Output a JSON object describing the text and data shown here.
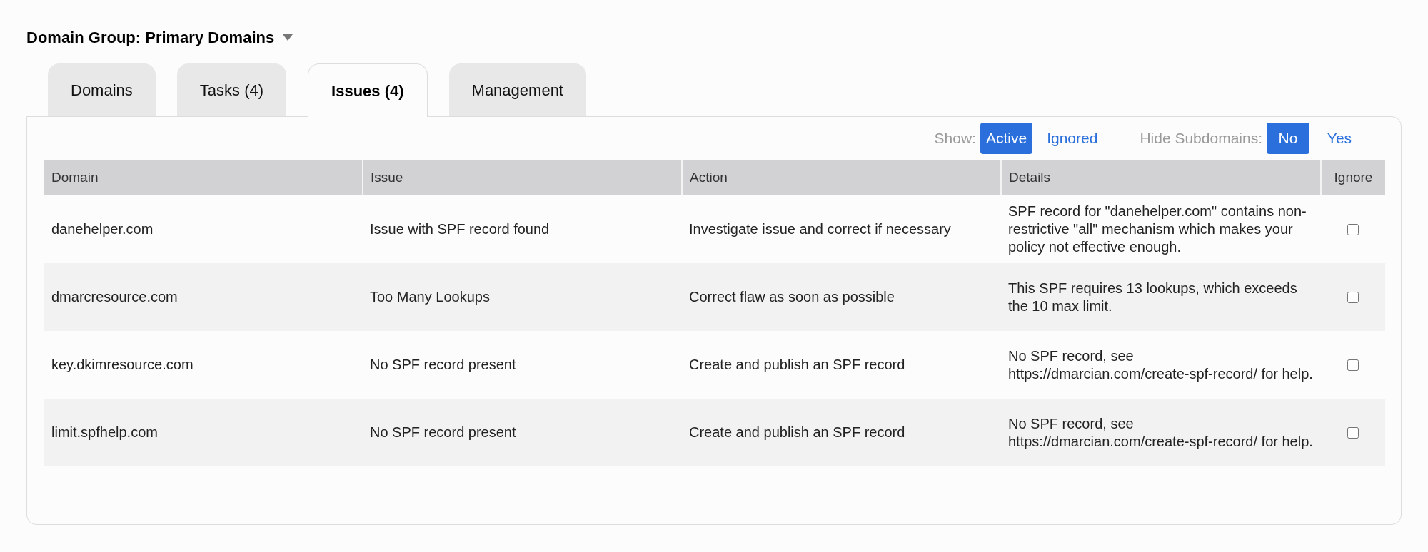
{
  "domain_group": {
    "label": "Domain Group: Primary Domains",
    "expanded": false
  },
  "tabs": [
    {
      "label": "Domains",
      "selected": false
    },
    {
      "label": "Tasks (4)",
      "selected": false
    },
    {
      "label": "Issues (4)",
      "selected": true
    },
    {
      "label": "Management",
      "selected": false
    }
  ],
  "filters": [
    {
      "label": "Show:",
      "options": [
        {
          "label": "Active",
          "selected": true
        },
        {
          "label": "Ignored",
          "selected": false
        }
      ]
    },
    {
      "label": "Hide Subdomains:",
      "options": [
        {
          "label": "No",
          "selected": true
        },
        {
          "label": "Yes",
          "selected": false
        }
      ]
    }
  ],
  "table": {
    "columns": [
      "Domain",
      "Issue",
      "Action",
      "Details",
      "Ignore"
    ],
    "rows": [
      {
        "domain": "danehelper.com",
        "issue": "Issue with SPF record found",
        "action": "Investigate issue and correct if necessary",
        "details": "SPF record for \"danehelper.com\" contains non-restrictive \"all\" mechanism which makes your policy not effective enough.",
        "ignored": false
      },
      {
        "domain": "dmarcresource.com",
        "issue": "Too Many Lookups",
        "action": "Correct flaw as soon as possible",
        "details": "This SPF requires 13 lookups, which exceeds the 10 max limit.",
        "ignored": false
      },
      {
        "domain": "key.dkimresource.com",
        "issue": "No SPF record present",
        "action": "Create and publish an SPF record",
        "details": "No SPF record, see https://dmarcian.com/create-spf-record/ for help.",
        "ignored": false
      },
      {
        "domain": "limit.spfhelp.com",
        "issue": "No SPF record present",
        "action": "Create and publish an SPF record",
        "details": "No SPF record, see https://dmarcian.com/create-spf-record/ for help.",
        "ignored": false
      }
    ]
  }
}
